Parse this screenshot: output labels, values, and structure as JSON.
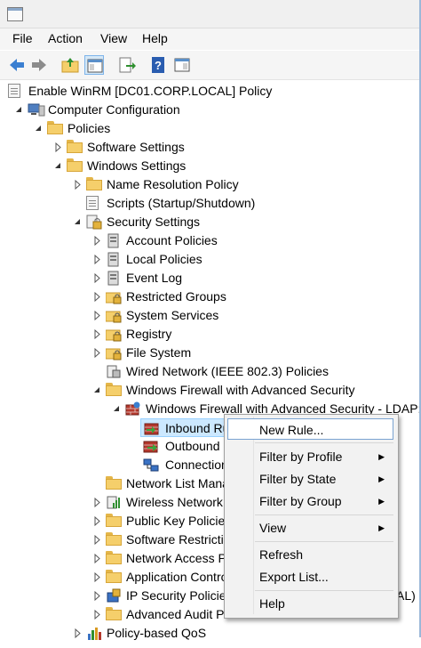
{
  "titlebar": {
    "title": ""
  },
  "menu": [
    {
      "label": "File"
    },
    {
      "label": "Action"
    },
    {
      "label": "View"
    },
    {
      "label": "Help"
    }
  ],
  "toolbar": {
    "buttons": [
      "back-arrow-icon",
      "forward-arrow-icon",
      "up-folder-icon",
      "show-hide-tree-icon",
      "export-list-icon",
      "help-icon",
      "properties-pane-icon"
    ]
  },
  "tree": {
    "root": "Enable WinRM [DC01.CORP.LOCAL] Policy",
    "computer_configuration": "Computer Configuration",
    "policies": "Policies",
    "software_settings": "Software Settings",
    "windows_settings": "Windows Settings",
    "name_resolution_policy": "Name Resolution Policy",
    "scripts": "Scripts (Startup/Shutdown)",
    "security_settings": "Security Settings",
    "account_policies": "Account Policies",
    "local_policies": "Local Policies",
    "event_log": "Event Log",
    "restricted_groups": "Restricted Groups",
    "system_services": "System Services",
    "registry": "Registry",
    "file_system": "File System",
    "wired_network": "Wired Network (IEEE 802.3) Policies",
    "windows_firewall": "Windows Firewall with Advanced Security",
    "windows_firewall_ldap": "Windows Firewall with Advanced Security - LDAP:/",
    "inbound_rules": "Inbound Ru",
    "outbound_rules": "Outbound",
    "connection_security": "Connection",
    "network_list_manager": "Network List Mana",
    "wireless_network": "Wireless Network (",
    "public_key_policies": "Public Key Policies",
    "software_restriction": "Software Restrictio",
    "network_access_protection": "Network Access Pr",
    "application_control": "Application Contro",
    "ip_security_policies": "IP Security Policies",
    "ip_security_tail": "AL)",
    "advanced_audit": "Advanced Audit P",
    "policy_qos": "Policy-based QoS"
  },
  "context_menu": {
    "new_rule": "New Rule...",
    "filter_profile": "Filter by Profile",
    "filter_state": "Filter by State",
    "filter_group": "Filter by Group",
    "view": "View",
    "refresh": "Refresh",
    "export_list": "Export List...",
    "help": "Help"
  },
  "colors": {
    "selection": "#cce8ff",
    "menu_highlight_border": "#7aa3d1",
    "folder": "#f5cf6b"
  }
}
